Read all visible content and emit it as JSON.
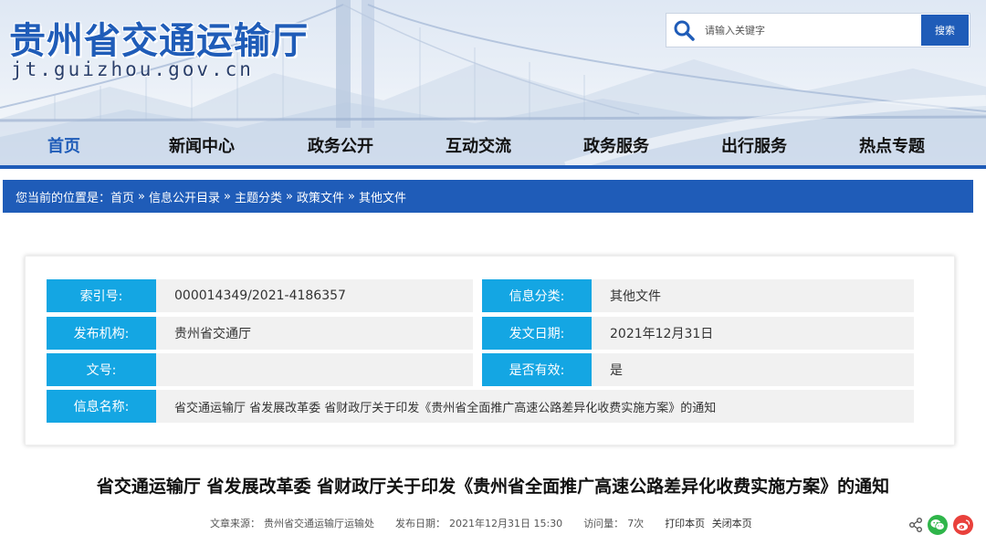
{
  "header": {
    "site_title": "贵州省交通运输厅",
    "site_domain": "jt.guizhou.gov.cn",
    "search_placeholder": "请输入关键字",
    "search_button": "搜索"
  },
  "nav": {
    "items": [
      {
        "label": "首页",
        "active": true
      },
      {
        "label": "新闻中心",
        "active": false
      },
      {
        "label": "政务公开",
        "active": false
      },
      {
        "label": "互动交流",
        "active": false
      },
      {
        "label": "政务服务",
        "active": false
      },
      {
        "label": "出行服务",
        "active": false
      },
      {
        "label": "热点专题",
        "active": false
      }
    ]
  },
  "breadcrumb": {
    "prefix": "您当前的位置是：",
    "separator": "»",
    "items": [
      "首页",
      "信息公开目录",
      "主题分类",
      "政策文件",
      "其他文件"
    ]
  },
  "info": {
    "index_label": "索引号:",
    "index_value": "000014349/2021-4186357",
    "category_label": "信息分类:",
    "category_value": "其他文件",
    "publisher_label": "发布机构:",
    "publisher_value": "贵州省交通厅",
    "date_label": "发文日期:",
    "date_value": "2021年12月31日",
    "doc_no_label": "文号:",
    "doc_no_value": "",
    "valid_label": "是否有效:",
    "valid_value": "是",
    "name_label": "信息名称:",
    "name_value": "省交通运输厅 省发展改革委 省财政厅关于印发《贵州省全面推广高速公路差异化收费实施方案》的通知"
  },
  "article": {
    "title": "省交通运输厅 省发展改革委 省财政厅关于印发《贵州省全面推广高速公路差异化收费实施方案》的通知",
    "source_label": "文章来源：",
    "source_value": "贵州省交通运输厅运输处",
    "publish_label": "发布日期：",
    "publish_value": "2021年12月31日 15:30",
    "views_label": "访问量：",
    "views_value": "7次",
    "print_link": "打印本页",
    "close_link": "关闭本页"
  },
  "colors": {
    "brand_blue": "#1f5cb8",
    "label_cyan": "#14a6e3",
    "wechat_green": "#2fb54a",
    "weibo_red": "#e9413c"
  },
  "icons": [
    "search-icon",
    "share-icon",
    "wechat-icon",
    "weibo-icon"
  ]
}
